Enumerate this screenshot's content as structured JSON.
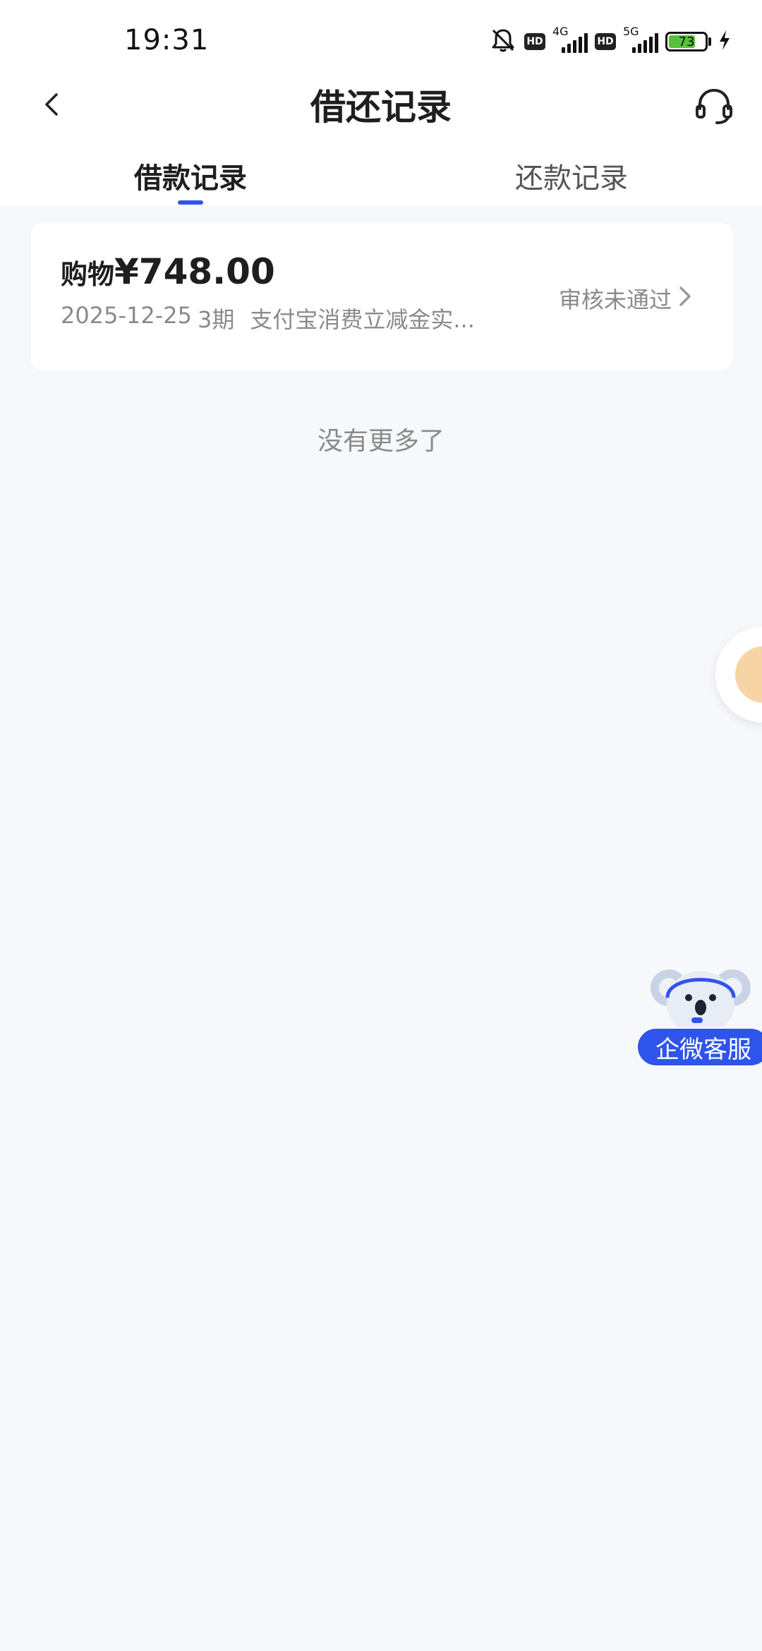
{
  "status_bar": {
    "time": "19:31",
    "net1_label": "4G",
    "net2_label": "5G",
    "hd_label": "HD",
    "battery": "73",
    "battery_level": 0.73,
    "battery_color": "#57c13b",
    "icons": [
      "mute-bell-icon",
      "hd-icon",
      "signal-4g-icon",
      "hd-icon",
      "signal-5g-icon",
      "battery-icon",
      "charging-bolt-icon"
    ]
  },
  "header": {
    "title": "借还记录",
    "back_icon": "chevron-left-icon",
    "service_icon": "headset-icon"
  },
  "tabs": [
    {
      "label": "借款记录",
      "active": true
    },
    {
      "label": "还款记录",
      "active": false
    }
  ],
  "accent_color": "#2f54eb",
  "records": [
    {
      "type": "购物",
      "amount": "¥748.00",
      "date": "2025-12-25",
      "term": "3期",
      "description": "支付宝消费立减金实...",
      "status": "审核未通过"
    }
  ],
  "list_end_text": "没有更多了",
  "floating_service": {
    "label": "企微客服",
    "icon": "koala-headset-icon"
  }
}
